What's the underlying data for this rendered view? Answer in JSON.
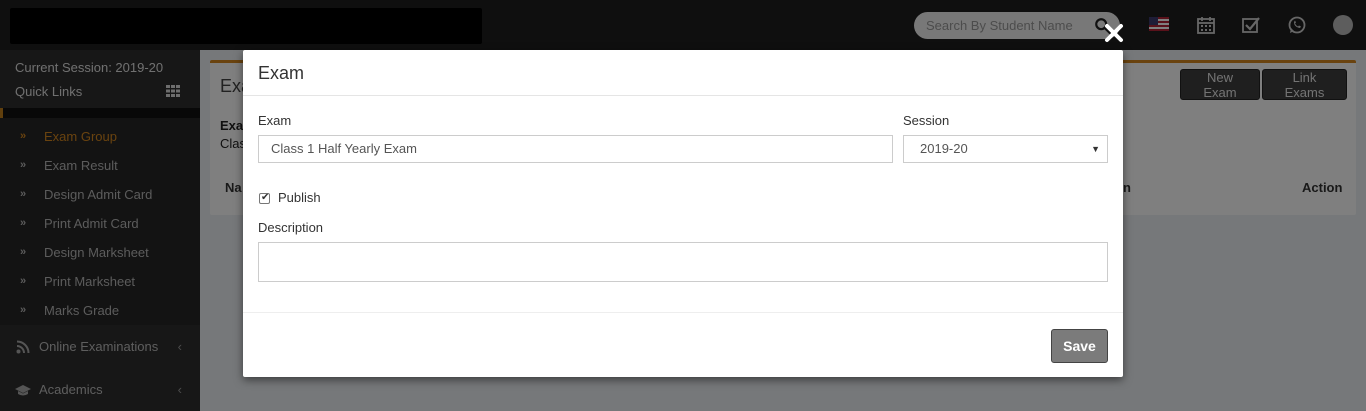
{
  "header": {
    "search_placeholder": "Search By Student Name",
    "icons": [
      "search-icon",
      "us-flag-icon",
      "calendar-icon",
      "task-check-icon",
      "whatsapp-icon",
      "user-avatar-icon"
    ]
  },
  "sidebar": {
    "current_session": "Current Session: 2019-20",
    "quick_links": "Quick Links",
    "sub_items": [
      {
        "label": "Exam Group",
        "active": true
      },
      {
        "label": "Exam Result",
        "active": false
      },
      {
        "label": "Design Admit Card",
        "active": false
      },
      {
        "label": "Print Admit Card",
        "active": false
      },
      {
        "label": "Design Marksheet",
        "active": false
      },
      {
        "label": "Print Marksheet",
        "active": false
      },
      {
        "label": "Marks Grade",
        "active": false
      }
    ],
    "menu_items": [
      {
        "label": "Online Examinations",
        "icon": "rss-icon"
      },
      {
        "label": "Academics",
        "icon": "graduation-cap-icon"
      }
    ]
  },
  "background": {
    "box_title": "Exa",
    "new_exam": "New Exam",
    "link_exams": "Link Exams",
    "label1": "Exa",
    "label2": "Clas",
    "col_name": "Na",
    "col_mid": "n",
    "col_action": "Action"
  },
  "modal": {
    "title": "Exam",
    "exam_label": "Exam",
    "exam_value": "Class 1  Half Yearly Exam",
    "session_label": "Session",
    "session_value": "2019-20",
    "publish_label": "Publish",
    "publish_checked": true,
    "description_label": "Description",
    "description_value": "",
    "save_label": "Save"
  },
  "colors": {
    "accent": "#d4861e",
    "topbar": "#1f1f1f",
    "sidebar": "#2e2e2e"
  }
}
